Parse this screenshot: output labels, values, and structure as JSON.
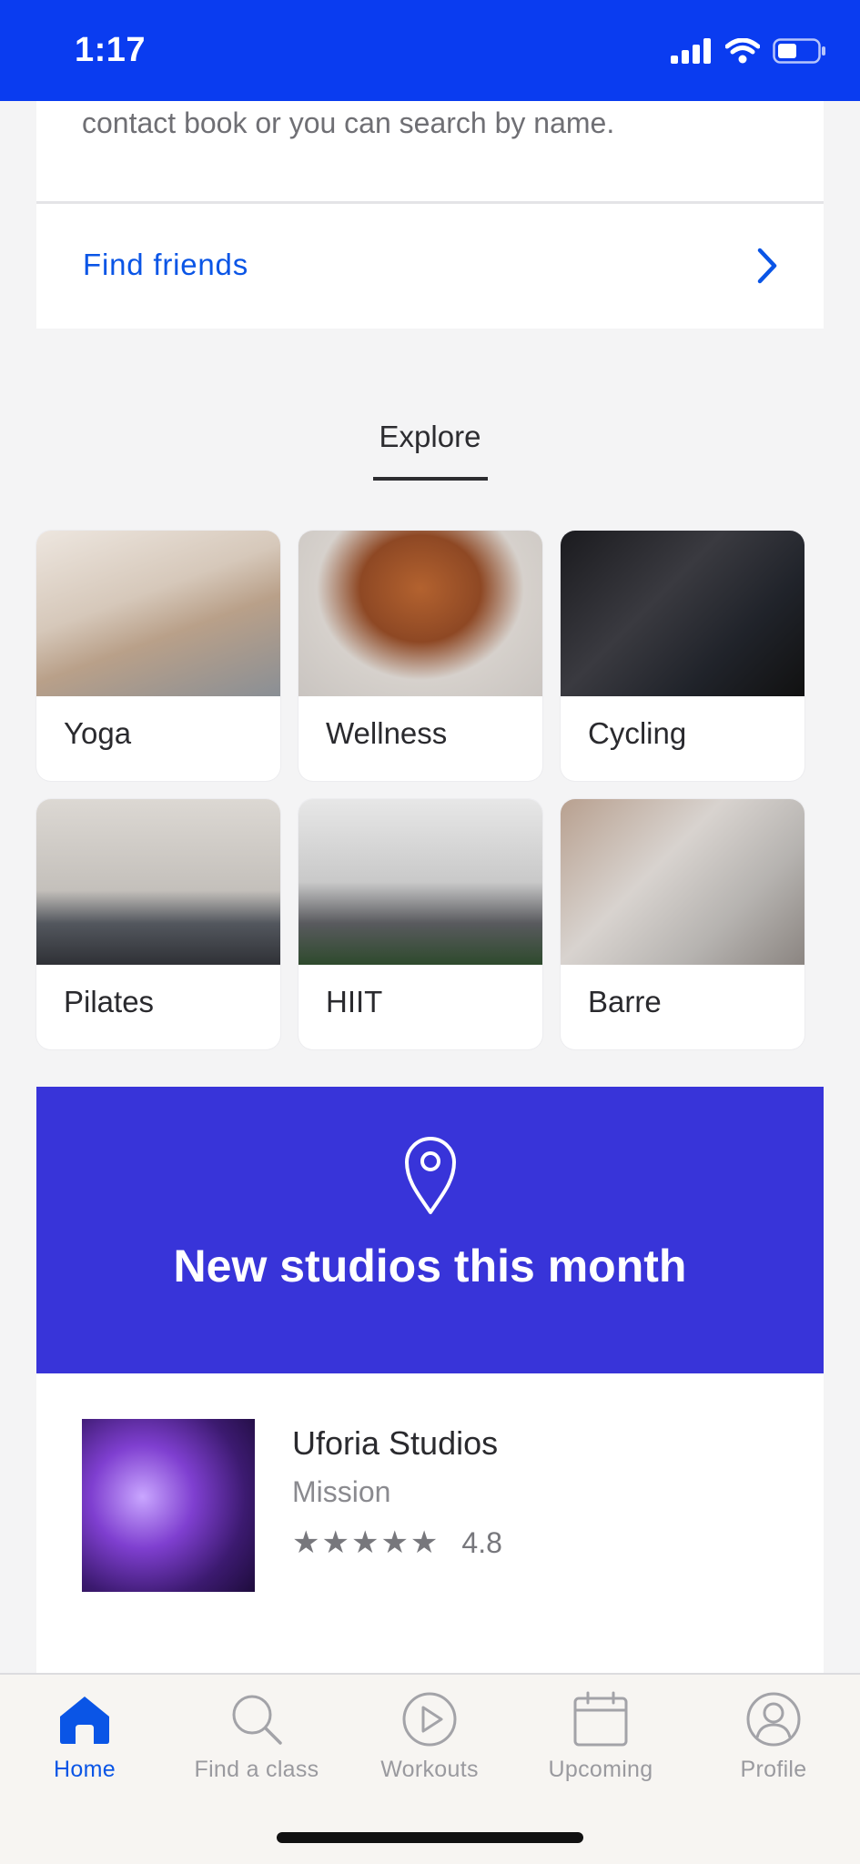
{
  "status_bar": {
    "time": "1:17"
  },
  "invite_card": {
    "text": "contact book or you can search by name.",
    "find_friends_label": "Find friends"
  },
  "explore": {
    "title": "Explore",
    "categories": [
      {
        "label": "Yoga"
      },
      {
        "label": "Wellness"
      },
      {
        "label": "Cycling"
      },
      {
        "label": "Pilates"
      },
      {
        "label": "HIIT"
      },
      {
        "label": "Barre"
      }
    ]
  },
  "banner": {
    "title": "New studios this month",
    "accent_color": "#3834d9"
  },
  "studio": {
    "name": "Uforia Studios",
    "location": "Mission",
    "stars": "★★★★★",
    "rating": "4.8"
  },
  "tab_bar": {
    "tabs": [
      {
        "label": "Home",
        "icon": "home-icon",
        "active": true
      },
      {
        "label": "Find a class",
        "icon": "search-icon",
        "active": false
      },
      {
        "label": "Workouts",
        "icon": "play-icon",
        "active": false
      },
      {
        "label": "Upcoming",
        "icon": "calendar-icon",
        "active": false
      },
      {
        "label": "Profile",
        "icon": "profile-icon",
        "active": false
      }
    ]
  },
  "colors": {
    "brand_blue": "#0a3cf0",
    "link_blue": "#0a55e6"
  }
}
